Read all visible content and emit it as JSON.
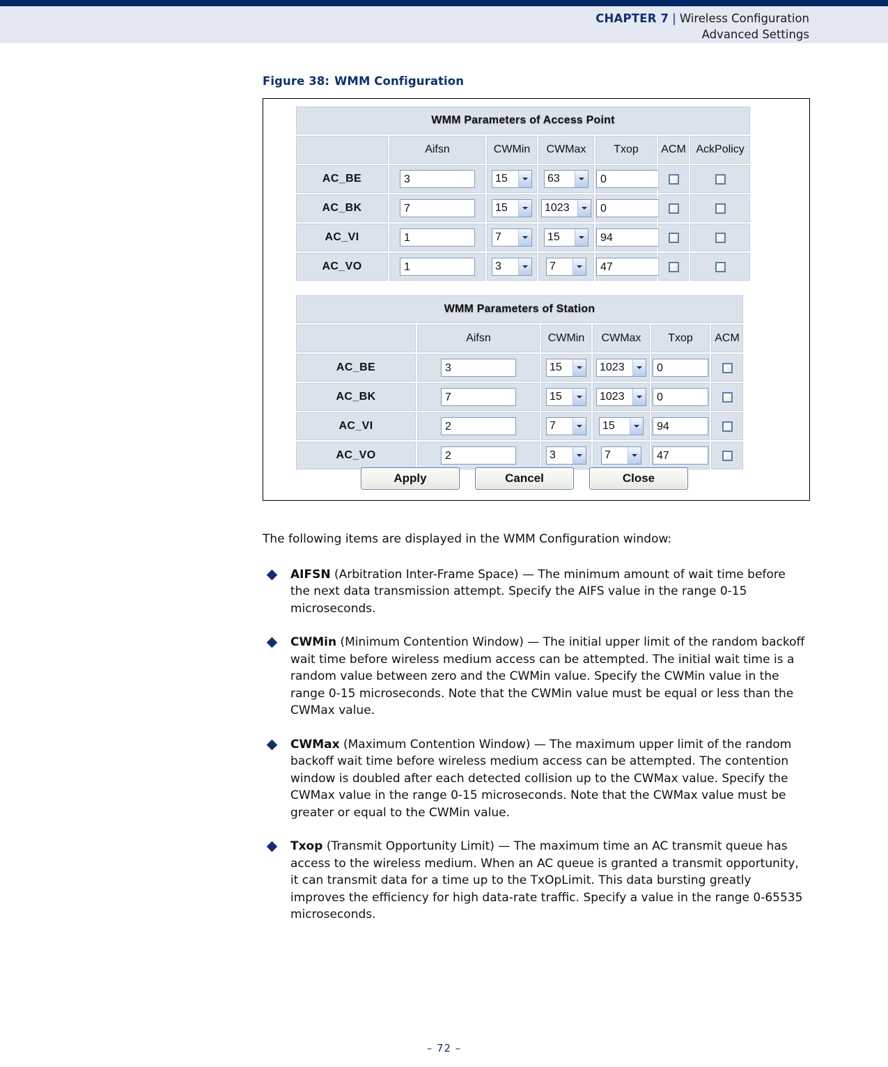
{
  "header": {
    "chapter": "CHAPTER 7",
    "separator": "|",
    "section": "Wireless Configuration",
    "subsection": "Advanced Settings"
  },
  "figure": {
    "caption_label": "Figure 38:",
    "caption_title": "WMM Configuration",
    "ap_table": {
      "title": "WMM Parameters of Access Point",
      "columns": [
        "",
        "Aifsn",
        "CWMin",
        "CWMax",
        "Txop",
        "ACM",
        "AckPolicy"
      ],
      "rows": [
        {
          "ac": "AC_BE",
          "aifsn": "3",
          "cwmin": "15",
          "cwmax": "63",
          "txop": "0",
          "acm": false,
          "ackpolicy": false
        },
        {
          "ac": "AC_BK",
          "aifsn": "7",
          "cwmin": "15",
          "cwmax": "1023",
          "txop": "0",
          "acm": false,
          "ackpolicy": false
        },
        {
          "ac": "AC_VI",
          "aifsn": "1",
          "cwmin": "7",
          "cwmax": "15",
          "txop": "94",
          "acm": false,
          "ackpolicy": false
        },
        {
          "ac": "AC_VO",
          "aifsn": "1",
          "cwmin": "3",
          "cwmax": "7",
          "txop": "47",
          "acm": false,
          "ackpolicy": false
        }
      ]
    },
    "sta_table": {
      "title": "WMM Parameters of Station",
      "columns": [
        "",
        "Aifsn",
        "CWMin",
        "CWMax",
        "Txop",
        "ACM"
      ],
      "rows": [
        {
          "ac": "AC_BE",
          "aifsn": "3",
          "cwmin": "15",
          "cwmax": "1023",
          "txop": "0",
          "acm": false
        },
        {
          "ac": "AC_BK",
          "aifsn": "7",
          "cwmin": "15",
          "cwmax": "1023",
          "txop": "0",
          "acm": false
        },
        {
          "ac": "AC_VI",
          "aifsn": "2",
          "cwmin": "7",
          "cwmax": "15",
          "txop": "94",
          "acm": false
        },
        {
          "ac": "AC_VO",
          "aifsn": "2",
          "cwmin": "3",
          "cwmax": "7",
          "txop": "47",
          "acm": false
        }
      ]
    },
    "buttons": {
      "apply": "Apply",
      "cancel": "Cancel",
      "close": "Close"
    }
  },
  "body": {
    "intro": "The following items are displayed in the WMM Configuration window:",
    "bullets": [
      {
        "term": "AIFSN",
        "text": " (Arbitration Inter-Frame Space) — The minimum amount of wait time before the next data transmission attempt. Specify the AIFS value in the range 0-15 microseconds."
      },
      {
        "term": "CWMin",
        "text": " (Minimum Contention Window) — The initial upper limit of the random backoff wait time before wireless medium access can be attempted. The initial wait time is a random value between zero and the CWMin value. Specify the CWMin value in the range 0-15 microseconds. Note that the CWMin value must be equal or less than the CWMax value."
      },
      {
        "term": "CWMax",
        "text": " (Maximum Contention Window) — The maximum upper limit of the random backoff wait time before wireless medium access can be attempted. The contention window is doubled after each detected collision up to the CWMax value. Specify the CWMax value in the range 0-15 microseconds. Note that the CWMax value must be greater or equal to the CWMin value."
      },
      {
        "term": "Txop",
        "text": " (Transmit Opportunity Limit) — The maximum time an AC transmit queue has access to the wireless medium. When an AC queue is granted a transmit opportunity, it can transmit data for a time up to the TxOpLimit. This data bursting greatly improves the efficiency for high data-rate traffic. Specify a value in the range 0-65535 microseconds."
      }
    ]
  },
  "footer": {
    "page_number": "–  72  –"
  },
  "colors": {
    "navy_rule": "#002664",
    "header_band": "#e4e8f2",
    "table_title_blue": "#4f7296",
    "table_row_blue": "#dbe2ec",
    "heading_navy": "#11306b"
  }
}
